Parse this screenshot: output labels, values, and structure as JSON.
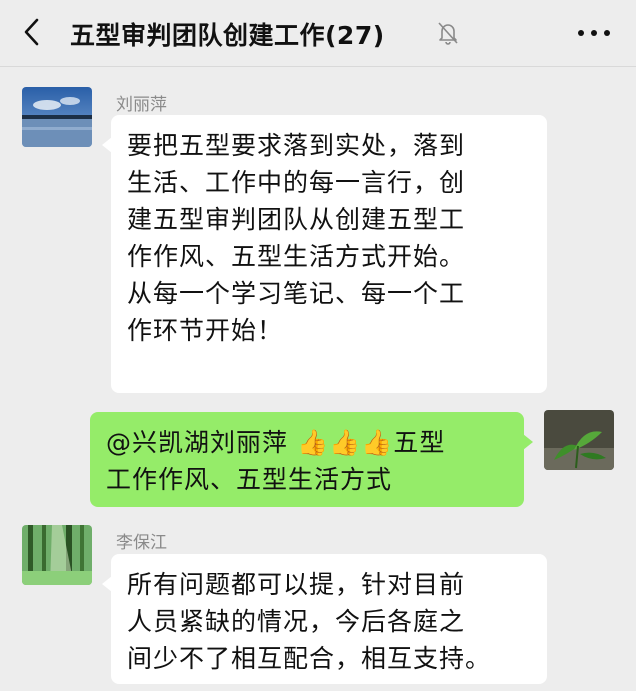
{
  "header": {
    "title": "五型审判团队创建工作(27)",
    "back_icon": "chevron-left-icon",
    "mute_icon": "bell-off-icon",
    "more_icon": "more-icon"
  },
  "messages": [
    {
      "sender": "刘丽萍",
      "direction": "incoming",
      "lines": [
        "要把五型要求落到实处，落到",
        "生活、工作中的每一言行，创",
        "建五型审判团队从创建五型工",
        "作作风、五型生活方式开始。",
        "从每一个学习笔记、每一个工",
        "作环节开始！"
      ]
    },
    {
      "sender": "",
      "direction": "outgoing",
      "lines": [
        "@兴凯湖刘丽萍 👍👍👍五型",
        "工作作风、五型生活方式"
      ]
    },
    {
      "sender": "李保江",
      "direction": "incoming",
      "lines": [
        "所有问题都可以提，针对目前",
        "人员紧缺的情况，今后各庭之",
        "间少不了相互配合，相互支持。"
      ]
    }
  ],
  "colors": {
    "background": "#ededed",
    "incoming_bubble": "#ffffff",
    "outgoing_bubble": "#95ec69",
    "sender_name": "#8a8a8a"
  }
}
